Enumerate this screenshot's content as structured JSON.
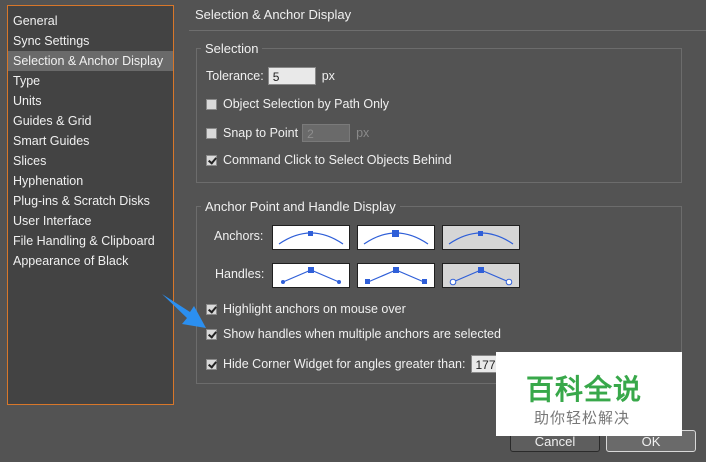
{
  "sidebar": {
    "items": [
      {
        "label": "General",
        "selected": false
      },
      {
        "label": "Sync Settings",
        "selected": false
      },
      {
        "label": "Selection & Anchor Display",
        "selected": true
      },
      {
        "label": "Type",
        "selected": false
      },
      {
        "label": "Units",
        "selected": false
      },
      {
        "label": "Guides & Grid",
        "selected": false
      },
      {
        "label": "Smart Guides",
        "selected": false
      },
      {
        "label": "Slices",
        "selected": false
      },
      {
        "label": "Hyphenation",
        "selected": false
      },
      {
        "label": "Plug-ins & Scratch Disks",
        "selected": false
      },
      {
        "label": "User Interface",
        "selected": false
      },
      {
        "label": "File Handling & Clipboard",
        "selected": false
      },
      {
        "label": "Appearance of Black",
        "selected": false
      }
    ]
  },
  "panel": {
    "title": "Selection & Anchor Display",
    "selection": {
      "title": "Selection",
      "tolerance_label": "Tolerance:",
      "tolerance_value": "5",
      "tolerance_unit": "px",
      "object_by_path_label": "Object Selection by Path Only",
      "object_by_path_checked": false,
      "snap_to_point_label": "Snap to Point",
      "snap_to_point_checked": false,
      "snap_value": "2",
      "snap_unit": "px",
      "command_click_label": "Command Click to Select Objects Behind",
      "command_click_checked": true
    },
    "anchor": {
      "title": "Anchor Point and Handle Display",
      "anchors_label": "Anchors:",
      "handles_label": "Handles:",
      "anchors_selected_index": 2,
      "handles_selected_index": 2,
      "highlight_label": "Highlight anchors on mouse over",
      "highlight_checked": true,
      "show_handles_label": "Show handles when multiple anchors are selected",
      "show_handles_checked": true,
      "hide_corner_label": "Hide Corner Widget for angles greater than:",
      "hide_corner_checked": true,
      "hide_corner_value": "177"
    }
  },
  "buttons": {
    "cancel": "Cancel",
    "ok": "OK"
  },
  "watermark": {
    "main": "百科全说",
    "sub": "助你轻松解决"
  },
  "colors": {
    "accent_border": "#d8772a",
    "curve_blue": "#2f5fd8",
    "arrow_blue": "#2b8ff0",
    "watermark_green": "#38a84a"
  },
  "icons": {
    "pointer": "arrow-pointer-icon"
  }
}
